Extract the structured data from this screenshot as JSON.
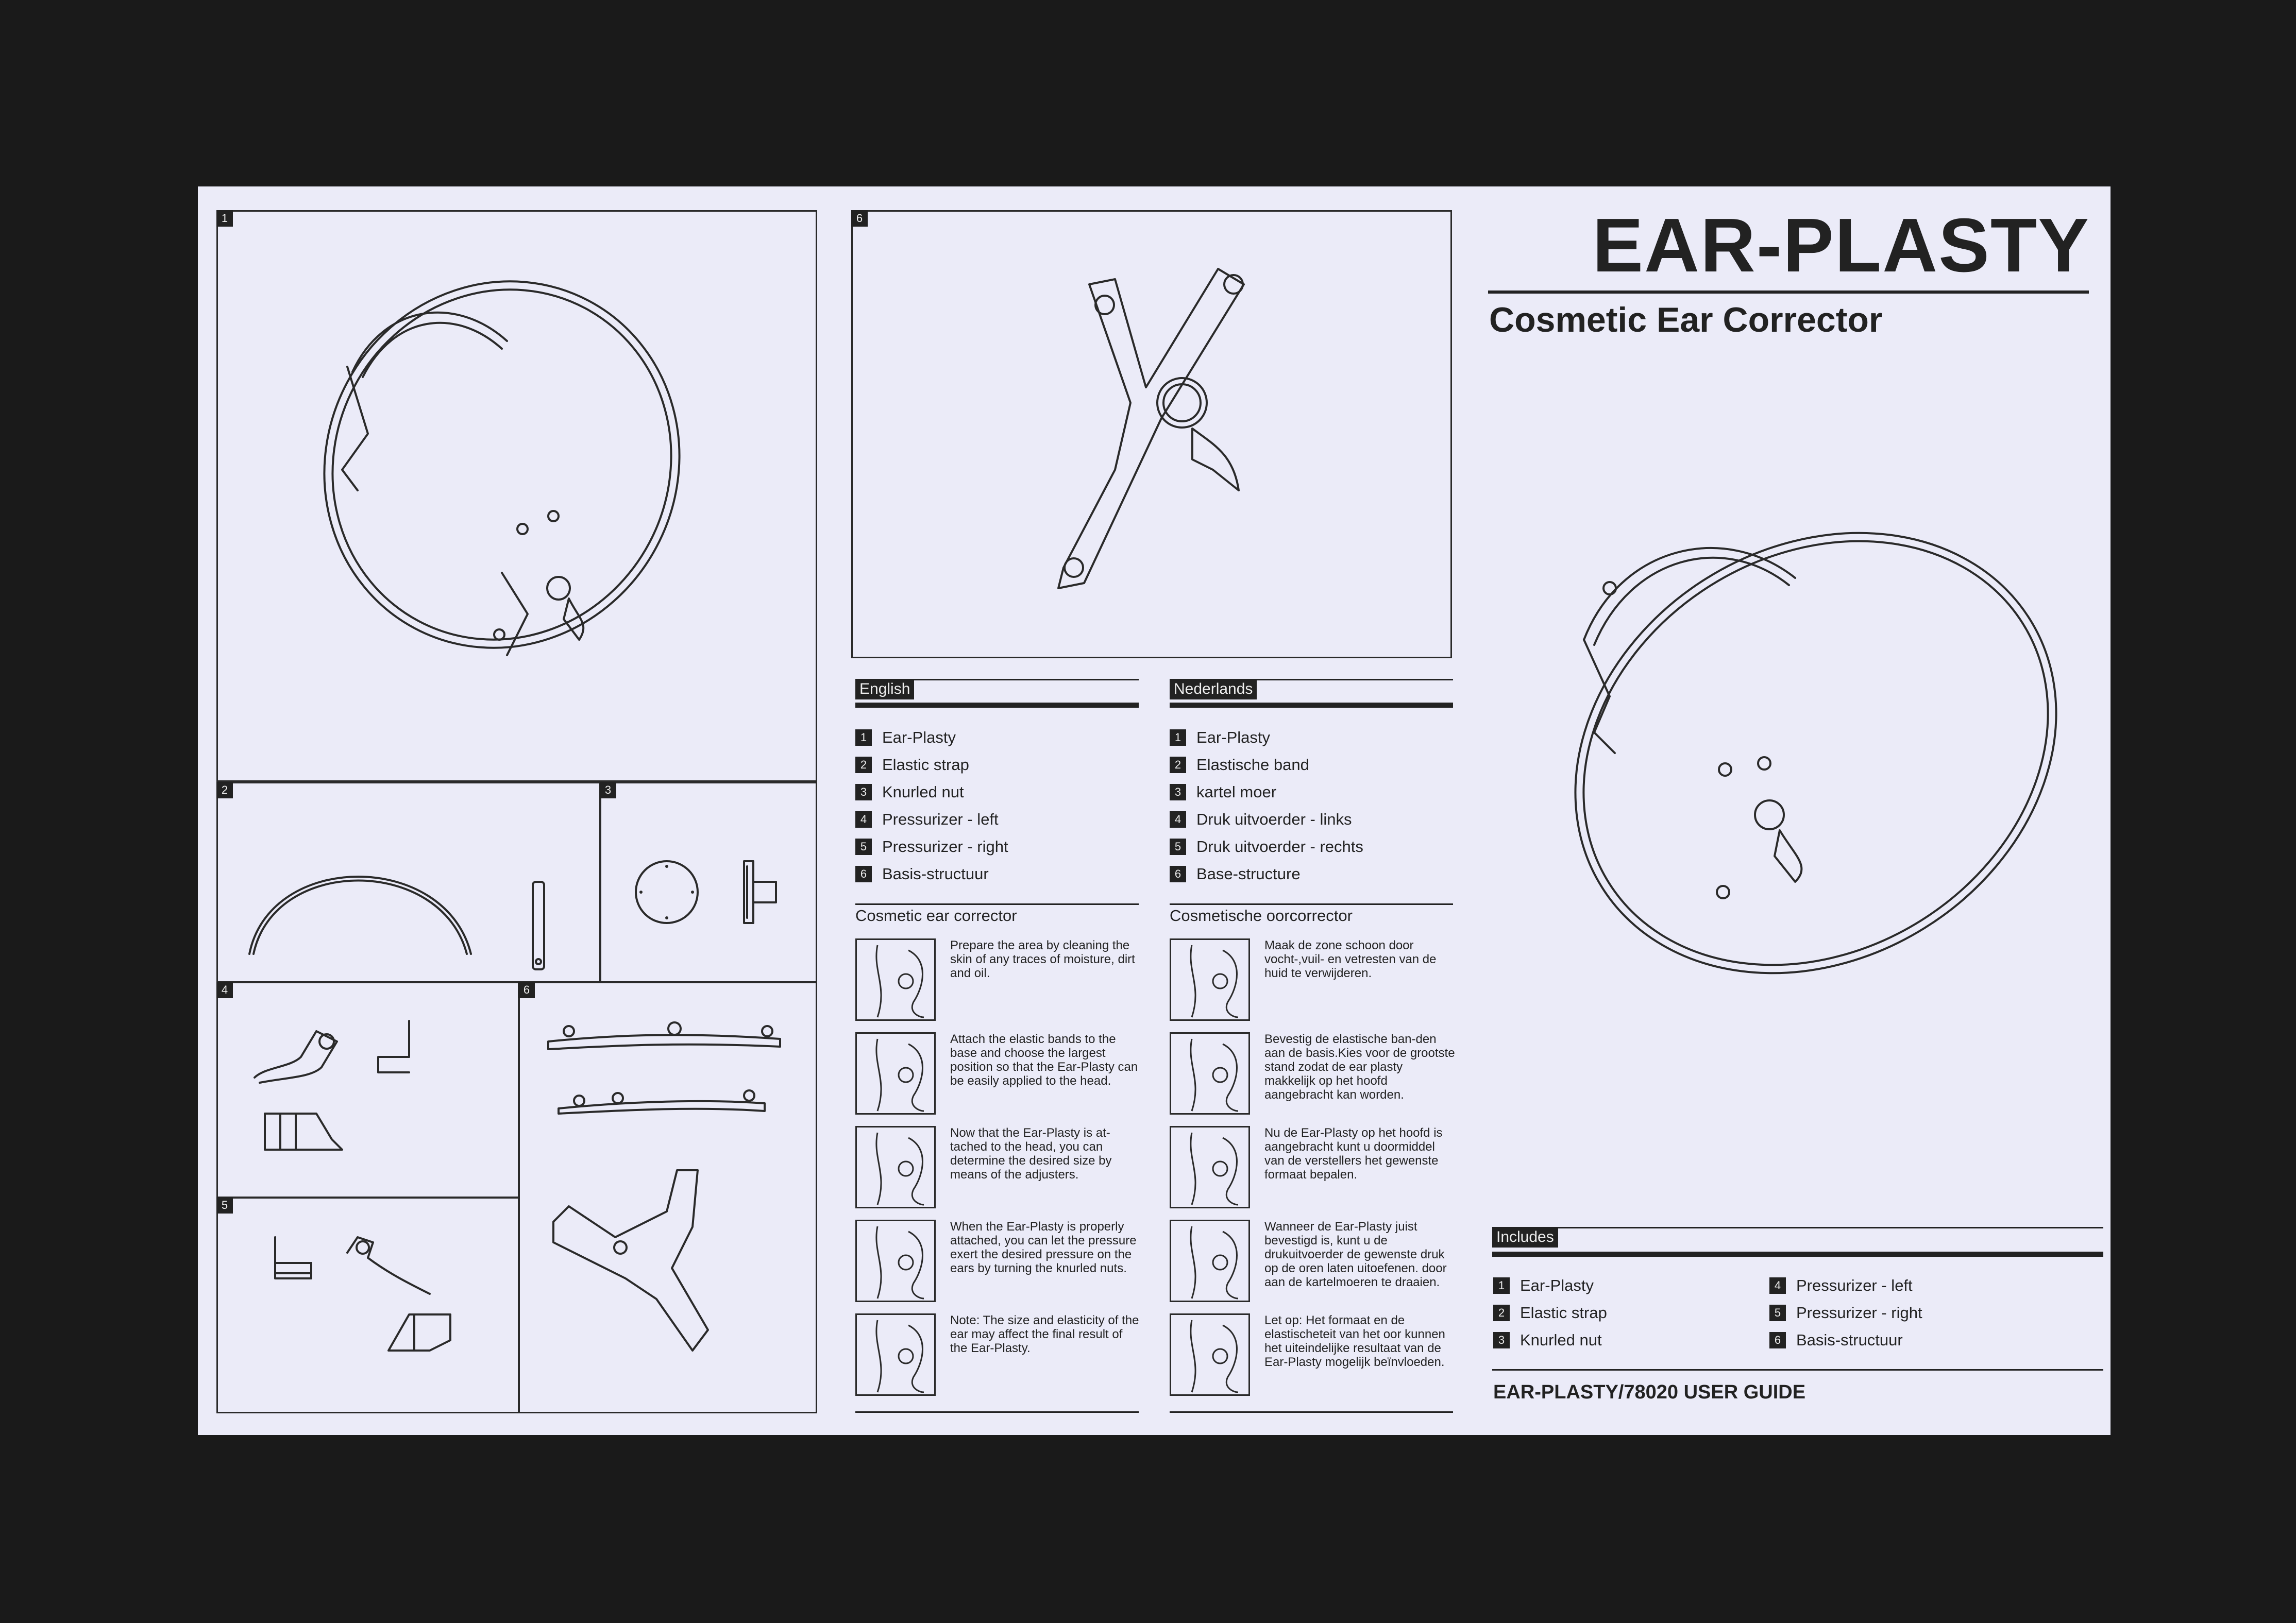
{
  "title": "EAR-PLASTY",
  "subtitle": "Cosmetic Ear Corrector",
  "figure_numbers": [
    "1",
    "2",
    "3",
    "4",
    "5",
    "6",
    "6"
  ],
  "english": {
    "tag": "English",
    "parts": [
      {
        "n": "1",
        "label": "Ear-Plasty"
      },
      {
        "n": "2",
        "label": "Elastic strap"
      },
      {
        "n": "3",
        "label": "Knurled nut"
      },
      {
        "n": "4",
        "label": "Pressurizer - left"
      },
      {
        "n": "5",
        "label": "Pressurizer - right"
      },
      {
        "n": "6",
        "label": "Basis-structuur"
      }
    ],
    "steps_title": "Cosmetic ear corrector",
    "steps": [
      "Prepare the area by cleaning the skin of any traces of moisture, dirt and oil.",
      "Attach the elastic bands to the base and choose the largest position so that the Ear-Plasty can be easily applied to the head.",
      "Now that the Ear-Plasty is at-tached to the head, you can determine the desired size by means of the adjusters.",
      "When the Ear-Plasty is properly attached, you can let the pressure exert the desired pressure on the ears by turning the knurled nuts.",
      "Note: The size and elasticity of the ear may affect the final result of the Ear-Plasty."
    ]
  },
  "dutch": {
    "tag": "Nederlands",
    "parts": [
      {
        "n": "1",
        "label": "Ear-Plasty"
      },
      {
        "n": "2",
        "label": "Elastische band"
      },
      {
        "n": "3",
        "label": "kartel moer"
      },
      {
        "n": "4",
        "label": "Druk uitvoerder - links"
      },
      {
        "n": "5",
        "label": "Druk uitvoerder - rechts"
      },
      {
        "n": "6",
        "label": "Base-structure"
      }
    ],
    "steps_title": "Cosmetische oorcorrector",
    "steps": [
      "Maak de zone schoon door vocht-,vuil- en vetresten van de huid te verwijderen.",
      "Bevestig de elastische ban-den aan de basis.Kies voor de grootste stand zodat de ear plasty makkelijk op het hoofd aangebracht kan worden.",
      "Nu de Ear-Plasty op het hoofd is aangebracht kunt u doormiddel van de verstellers het gewenste formaat bepalen.",
      "Wanneer de Ear-Plasty juist bevestigd is, kunt u de drukuitvoerder de gewenste druk op de oren laten uitoefenen. door aan de kartelmoeren te draaien.",
      "Let op: Het formaat en de elastischeteit van het oor kunnen het uiteindelijke resultaat van de Ear-Plasty mogelijk beïnvloeden."
    ]
  },
  "includes": {
    "tag": "Includes",
    "items": [
      {
        "n": "1",
        "label": "Ear-Plasty"
      },
      {
        "n": "2",
        "label": "Elastic strap"
      },
      {
        "n": "3",
        "label": "Knurled nut"
      },
      {
        "n": "4",
        "label": "Pressurizer - left"
      },
      {
        "n": "5",
        "label": "Pressurizer - right"
      },
      {
        "n": "6",
        "label": "Basis-structuur"
      }
    ]
  },
  "footer": "EAR-PLASTY/78020 USER GUIDE",
  "colors": {
    "background": "#1a1a1a",
    "paper": "#ebebf8",
    "ink": "#222222"
  }
}
